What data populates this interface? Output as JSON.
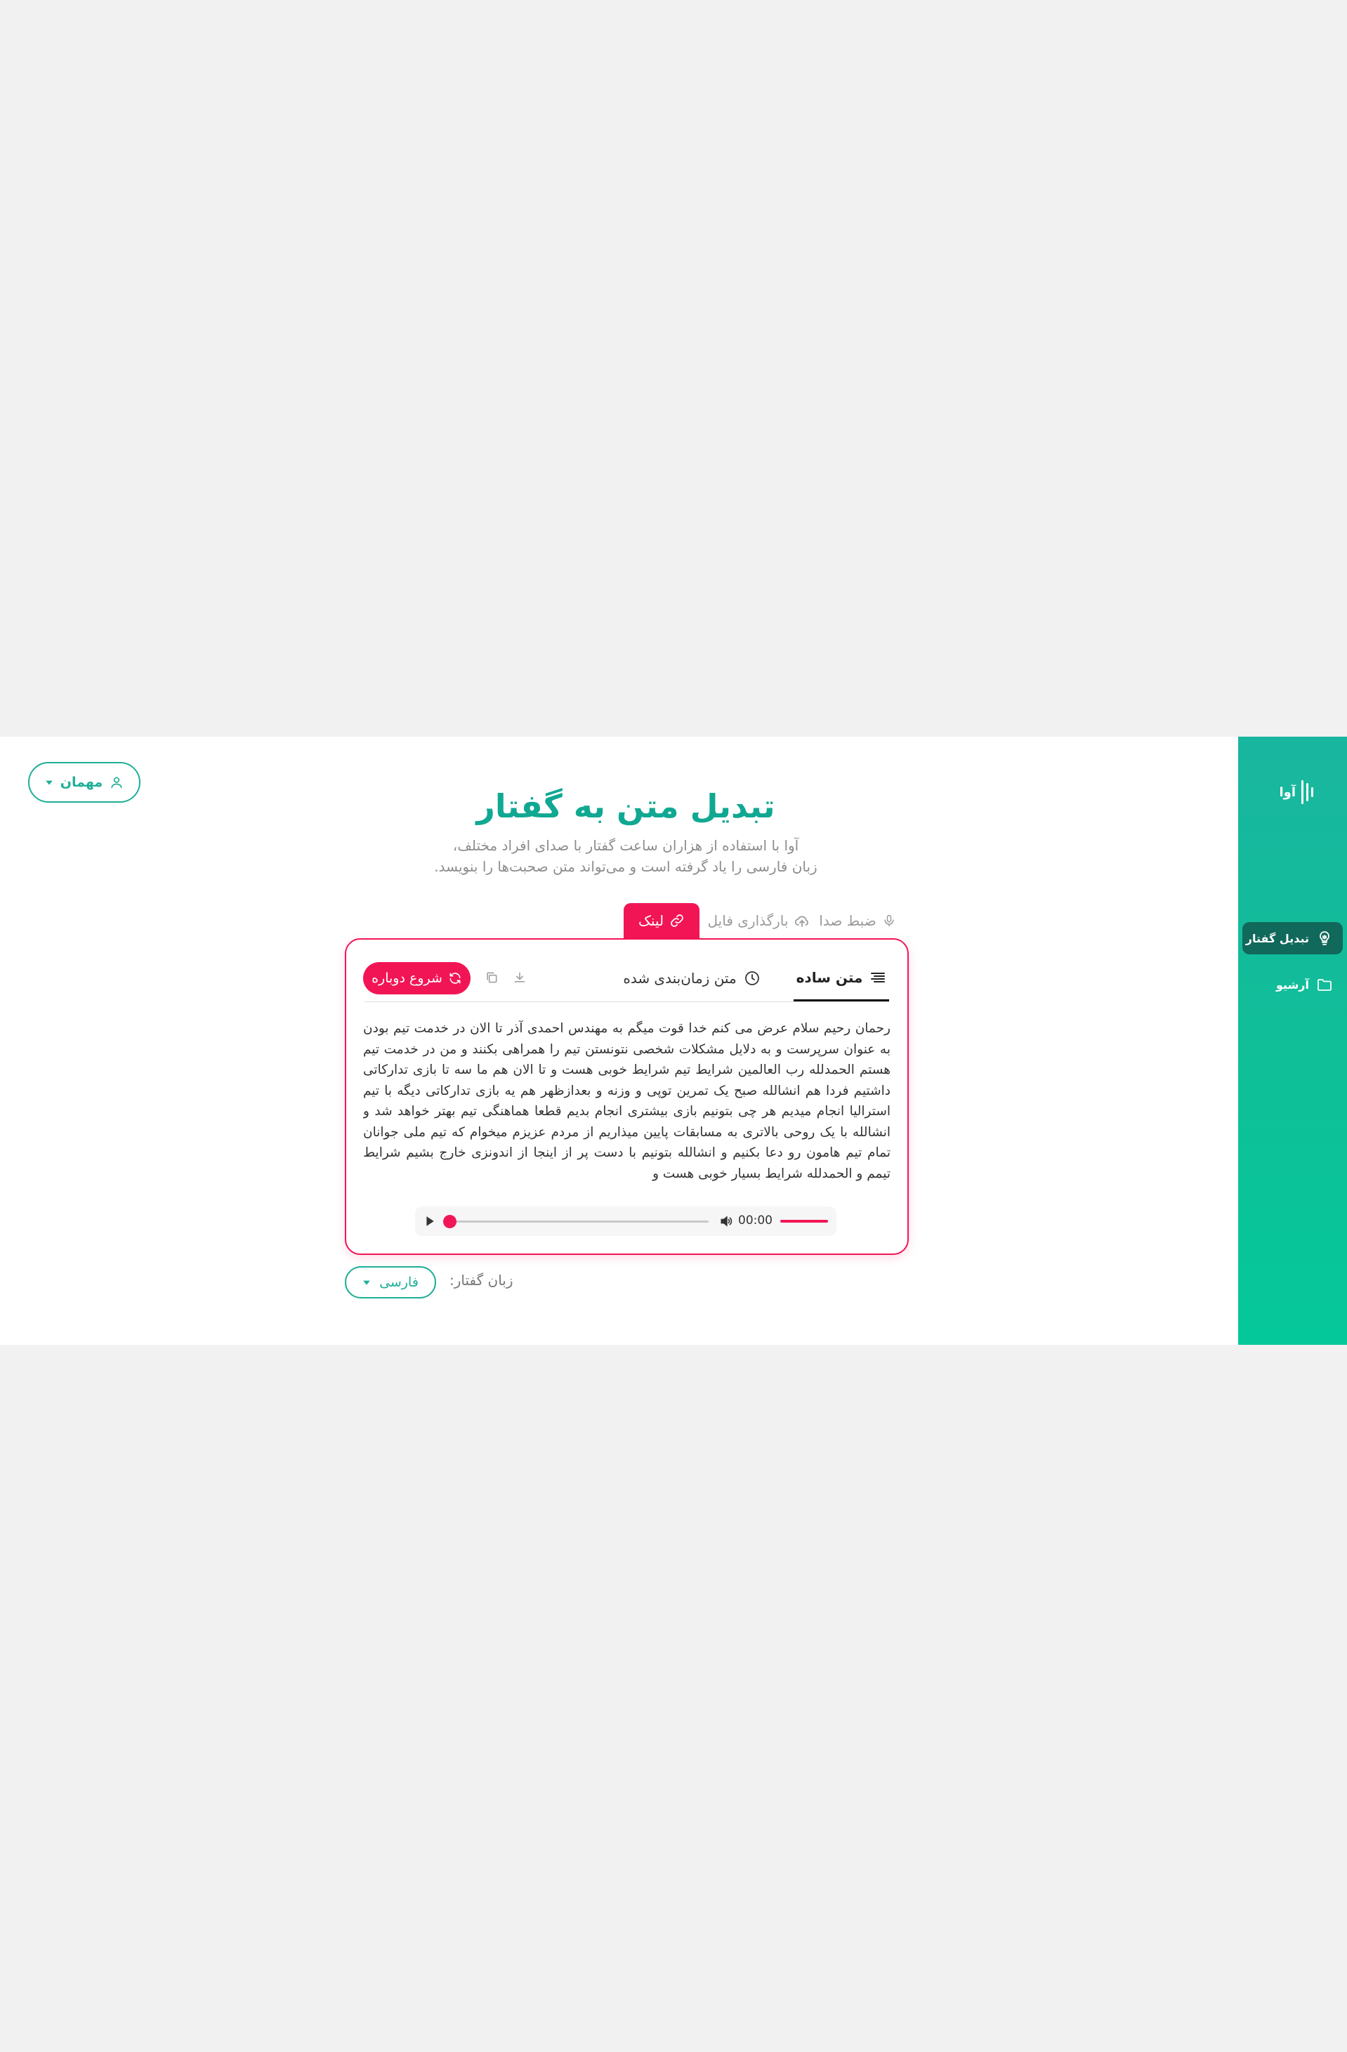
{
  "sidebar": {
    "brand": "آوا",
    "items": [
      {
        "label": "تبدیل گفتار",
        "icon": "speech-bulb-icon",
        "active": true
      },
      {
        "label": "آرشیو",
        "icon": "folder-icon",
        "active": false
      }
    ]
  },
  "header": {
    "user_label": "مهمان",
    "title": "تبدیل متن به گفتار",
    "subtitle_line1": "آوا با استفاده از هزاران ساعت گفتار با صدای افراد مختلف،",
    "subtitle_line2": "زبان فارسی را یاد گرفته است و می‌تواند متن صحبت‌ها را بنویسد."
  },
  "input_tabs": [
    {
      "label": "ضبط صدا",
      "icon": "microphone-icon",
      "active": false
    },
    {
      "label": "بارگذاری فایل",
      "icon": "upload-cloud-icon",
      "active": false
    },
    {
      "label": "لینک",
      "icon": "link-icon",
      "active": true
    }
  ],
  "result": {
    "tabs": [
      {
        "label": "متن ساده",
        "icon": "lines-icon",
        "active": true
      },
      {
        "label": "متن زمان‌بندی شده",
        "icon": "clock-icon",
        "active": false
      }
    ],
    "restart_label": "شروع دوباره",
    "transcript": "رحمان رحیم سلام عرض می کنم خدا قوت میگم به مهندس احمدی آذر تا الان در خدمت تیم بودن به عنوان سرپرست و به دلایل مشکلات شخصی نتونستن تیم را همراهی بکنند و من در خدمت تیم هستم الحمدلله رب العالمین شرایط تیم شرایط خوبی هست و تا الان هم ما سه تا بازی تدارکاتی داشتیم فردا هم انشالله صبح یک تمرین توپی و وزنه و بعدازظهر هم یه بازی تدارکاتی دیگه با تیم استرالیا انجام میدیم هر چی بتونیم بازی بیشتری انجام بدیم قطعا هماهنگی تیم بهتر خواهد شد و انشالله با یک روحی بالاتری به مسابقات پایین میذاریم از مردم عزیزم میخوام که تیم ملی جوانان تمام تیم هامون رو دعا بکنیم و انشالله بتونیم با دست پر از اینجا از اندونزی خارج بشیم شرایط تیمم و الحمدلله شرایط بسیار خوبی هست و",
    "player": {
      "time": "00:00",
      "position": 0
    }
  },
  "language": {
    "label": "زبان گفتار:",
    "selected": "فارسی"
  },
  "colors": {
    "brand_green": "#1fae98",
    "accent_red": "#f21556",
    "active_nav": "#11695b"
  }
}
